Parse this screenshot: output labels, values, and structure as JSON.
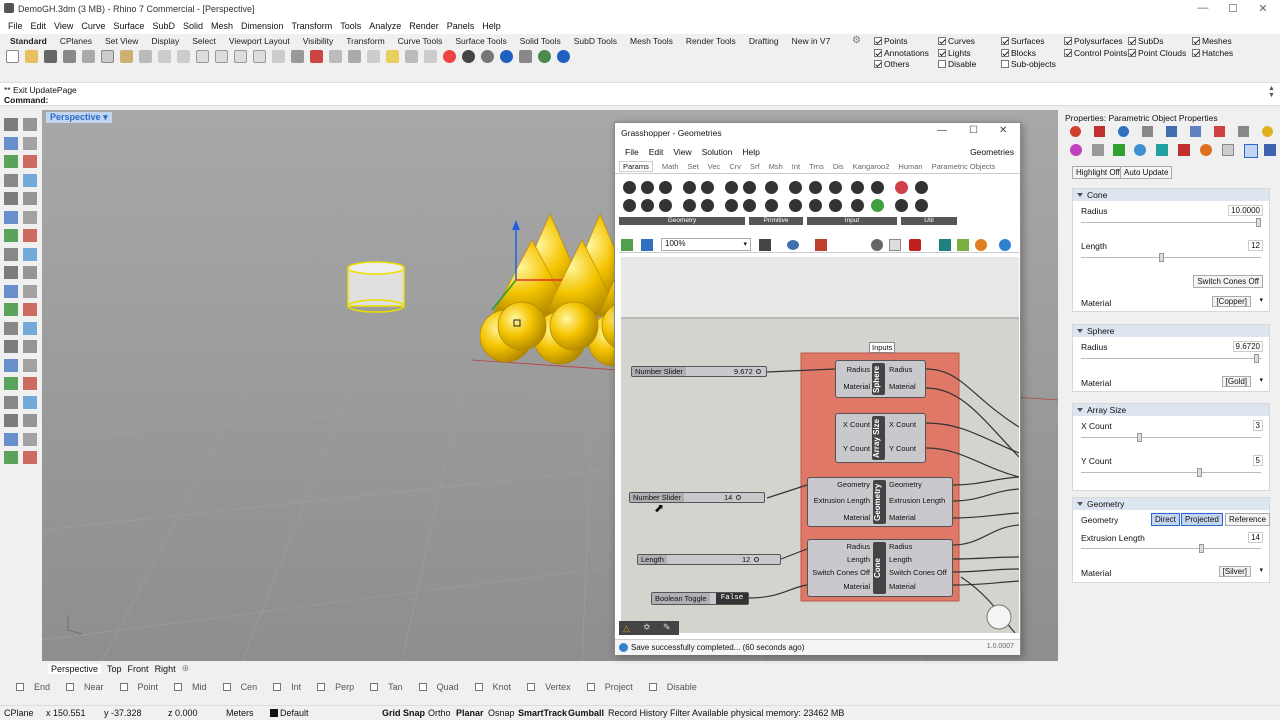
{
  "window": {
    "title": "DemoGH.3dm (3 MB) - Rhino 7 Commercial - [Perspective]"
  },
  "menu": [
    "File",
    "Edit",
    "View",
    "Curve",
    "Surface",
    "SubD",
    "Solid",
    "Mesh",
    "Dimension",
    "Transform",
    "Tools",
    "Analyze",
    "Render",
    "Panels",
    "Help"
  ],
  "toolbar_tabs": [
    "Standard",
    "CPlanes",
    "Set View",
    "Display",
    "Select",
    "Viewport Layout",
    "Visibility",
    "Transform",
    "Curve Tools",
    "Surface Tools",
    "Solid Tools",
    "SubD Tools",
    "Mesh Tools",
    "Render Tools",
    "Drafting",
    "New in V7"
  ],
  "filters": {
    "col1": [
      {
        "label": "Points",
        "on": true
      },
      {
        "label": "Annotations",
        "on": true
      },
      {
        "label": "Others",
        "on": true
      }
    ],
    "col2": [
      {
        "label": "Curves",
        "on": true
      },
      {
        "label": "Lights",
        "on": true
      },
      {
        "label": "Disable",
        "on": false
      }
    ],
    "col3": [
      {
        "label": "Surfaces",
        "on": true
      },
      {
        "label": "Blocks",
        "on": true
      },
      {
        "label": "Sub-objects",
        "on": false
      }
    ],
    "col4": [
      {
        "label": "Polysurfaces",
        "on": true
      },
      {
        "label": "Control Points",
        "on": true
      }
    ],
    "col5": [
      {
        "label": "SubDs",
        "on": true
      },
      {
        "label": "Point Clouds",
        "on": true
      }
    ],
    "col6": [
      {
        "label": "Meshes",
        "on": true
      },
      {
        "label": "Hatches",
        "on": true
      }
    ]
  },
  "command": {
    "history": "** Exit UpdatePage",
    "prompt": "Command:"
  },
  "viewport": {
    "name": "Perspective"
  },
  "viewport_tabs": [
    "Perspective",
    "Top",
    "Front",
    "Right"
  ],
  "snaps": [
    {
      "label": "End",
      "on": false
    },
    {
      "label": "Near",
      "on": false
    },
    {
      "label": "Point",
      "on": false
    },
    {
      "label": "Mid",
      "on": false
    },
    {
      "label": "Cen",
      "on": false
    },
    {
      "label": "Int",
      "on": false
    },
    {
      "label": "Perp",
      "on": false
    },
    {
      "label": "Tan",
      "on": false
    },
    {
      "label": "Quad",
      "on": false
    },
    {
      "label": "Knot",
      "on": false
    },
    {
      "label": "Vertex",
      "on": false
    },
    {
      "label": "Project",
      "on": false
    },
    {
      "label": "Disable",
      "on": false
    }
  ],
  "status": {
    "cplane": "CPlane",
    "x": "x 150.551",
    "y": "y -37.328",
    "z": "z 0.000",
    "units": "Meters",
    "layer": "Default",
    "grid_snap": "Grid Snap",
    "ortho": "Ortho",
    "planar": "Planar",
    "osnap": "Osnap",
    "smarttrack": "SmartTrack",
    "gumball": "Gumball",
    "record": "Record History",
    "filter": "Filter",
    "memory": "Available physical memory: 23462 MB"
  },
  "properties": {
    "title": "Properties: Parametric Object Properties",
    "highlight_btn": "Highlight Off",
    "auto_update_btn": "Auto Update",
    "cone": {
      "header": "Cone",
      "radius_label": "Radius",
      "radius_value": "10.0000",
      "length_label": "Length",
      "length_value": "12",
      "switch_btn": "Switch Cones Off",
      "material_label": "Material",
      "material_value": "[Copper]"
    },
    "sphere": {
      "header": "Sphere",
      "radius_label": "Radius",
      "radius_value": "9.6720",
      "material_label": "Material",
      "material_value": "[Gold]"
    },
    "array": {
      "header": "Array Size",
      "x_label": "X Count",
      "x_value": "3",
      "y_label": "Y Count",
      "y_value": "5"
    },
    "geometry": {
      "header": "Geometry",
      "geom_label": "Geometry",
      "direct": "Direct",
      "projected": "Projected",
      "reference": "Reference",
      "ext_label": "Extrusion Length",
      "ext_value": "14",
      "material_label": "Material",
      "material_value": "[Silver]"
    }
  },
  "grasshopper": {
    "title": "Grasshopper - Geometries",
    "menu": [
      "File",
      "Edit",
      "View",
      "Solution",
      "Help"
    ],
    "doc_name": "Geometries",
    "tabs": [
      "Params",
      "Math",
      "Set",
      "Vec",
      "Crv",
      "Srf",
      "Msh",
      "Int",
      "Trns",
      "Dis",
      "Kangaroo2",
      "Human",
      "Parametric Objects"
    ],
    "groups": [
      "Geometry",
      "Primitive",
      "Input",
      "Util"
    ],
    "zoom": "100%",
    "group_label": "Inputs",
    "slider1": {
      "label": "Number Slider",
      "value": "9.672"
    },
    "slider2": {
      "label": "Number Slider",
      "value": "14"
    },
    "slider3": {
      "label": "Length",
      "value": "12"
    },
    "toggle": {
      "label": "Boolean Toggle",
      "value": "False"
    },
    "sphere": {
      "name": "Sphere",
      "in1": "Radius",
      "in2": "Material",
      "out1": "Radius",
      "out2": "Material"
    },
    "array": {
      "name": "Array Size",
      "in1": "X Count",
      "in2": "Y Count",
      "out1": "X Count",
      "out2": "Y Count"
    },
    "geometry": {
      "name": "Geometry",
      "in1": "Geometry",
      "in2": "Extrusion Length",
      "in3": "Material",
      "out1": "Geometry",
      "out2": "Extrusion Length",
      "out3": "Material"
    },
    "cone": {
      "name": "Cone",
      "in1": "Radius",
      "in2": "Length",
      "in3": "Switch Cones Off",
      "in4": "Material",
      "out1": "Radius",
      "out2": "Length",
      "out3": "Switch Cones Off",
      "out4": "Material"
    },
    "status": "Save successfully completed... (60 seconds ago)",
    "version": "1.0.0007"
  },
  "colors": {
    "accent": "#2a6ad0",
    "group_fill": "#e07868",
    "gold": "#f5c400"
  }
}
